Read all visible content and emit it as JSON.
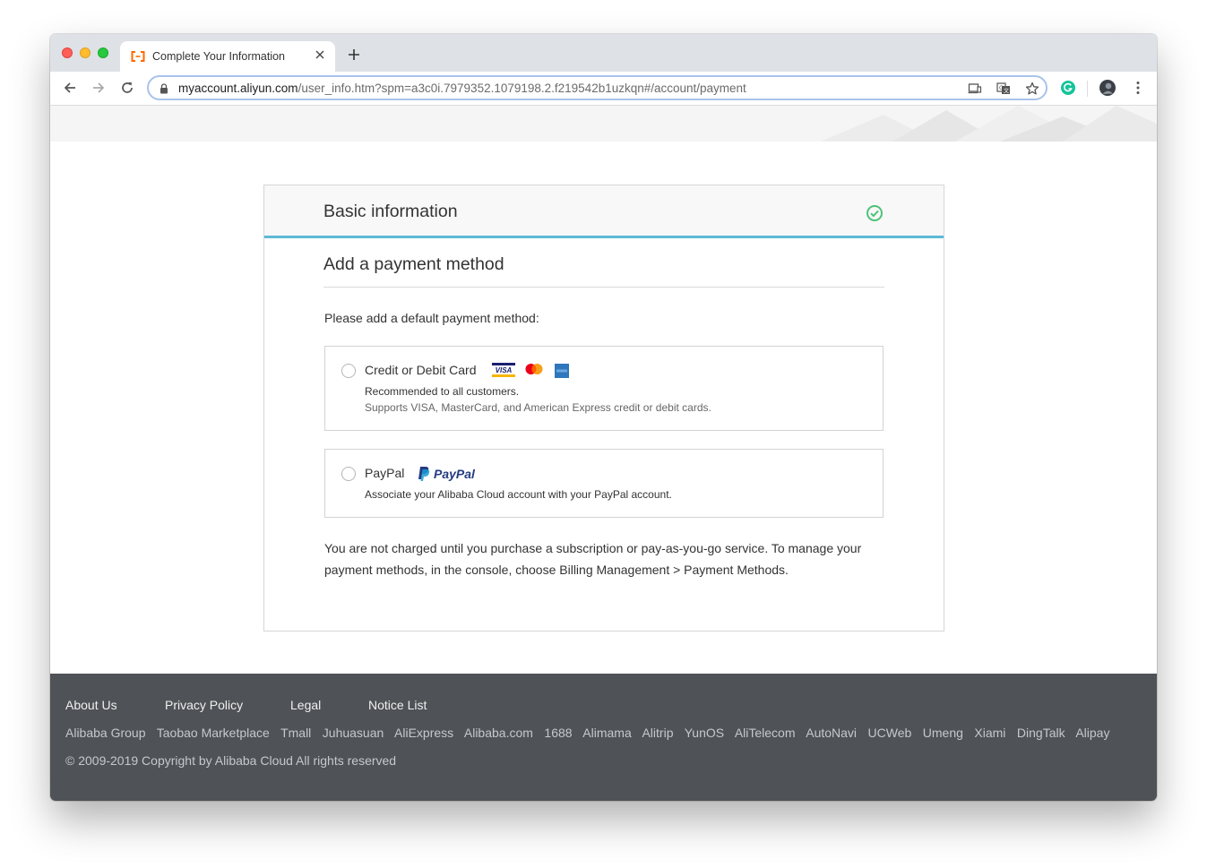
{
  "browser": {
    "tab_title": "Complete Your Information",
    "url_host": "myaccount.aliyun.com",
    "url_path": "/user_info.htm?spm=a3c0i.7979352.1079198.2.f219542b1uzkqn#/account/payment"
  },
  "card": {
    "header_title": "Basic information",
    "section_title": "Add a payment method",
    "prompt": "Please add a default payment method:",
    "options": [
      {
        "title": "Credit or Debit Card",
        "line1": "Recommended to all customers.",
        "line2": "Supports VISA, MasterCard, and American Express credit or debit cards.",
        "logos": [
          "visa-logo",
          "mastercard-logo",
          "amex-logo"
        ]
      },
      {
        "title": "PayPal",
        "logo_text": "PayPal",
        "line1": "Associate your Alibaba Cloud account with your PayPal account."
      }
    ],
    "note": "You are not charged until you purchase a subscription or pay-as-you-go service. To manage your payment methods, in the console, choose Billing Management > Payment Methods."
  },
  "footer": {
    "main_links": [
      "About Us",
      "Privacy Policy",
      "Legal",
      "Notice List"
    ],
    "group_links": [
      "Alibaba Group",
      "Taobao Marketplace",
      "Tmall",
      "Juhuasuan",
      "AliExpress",
      "Alibaba.com",
      "1688",
      "Alimama",
      "Alitrip",
      "YunOS",
      "AliTelecom",
      "AutoNavi",
      "UCWeb",
      "Umeng",
      "Xiami",
      "DingTalk",
      "Alipay"
    ],
    "copyright": "© 2009-2019 Copyright by Alibaba Cloud All rights reserved"
  },
  "colors": {
    "accent": "#5bbad5",
    "check_green": "#4cc37a",
    "footer_bg": "#4f5256",
    "brand_orange": "#ff6a00"
  }
}
